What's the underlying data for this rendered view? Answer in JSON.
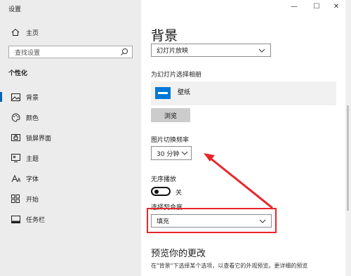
{
  "window": {
    "title": "设置"
  },
  "sidebar": {
    "home": "主页",
    "search_placeholder": "查找设置",
    "section": "个性化",
    "items": [
      {
        "label": "背景",
        "icon": "image-icon",
        "active": true
      },
      {
        "label": "颜色",
        "icon": "palette-icon",
        "active": false
      },
      {
        "label": "锁屏界面",
        "icon": "lock-screen-icon",
        "active": false
      },
      {
        "label": "主题",
        "icon": "theme-icon",
        "active": false
      },
      {
        "label": "字体",
        "icon": "font-icon",
        "active": false
      },
      {
        "label": "开始",
        "icon": "start-icon",
        "active": false
      },
      {
        "label": "任务栏",
        "icon": "taskbar-icon",
        "active": false
      }
    ]
  },
  "window_controls": {
    "minimize": "—",
    "maximize": "☐",
    "close": "✕"
  },
  "main": {
    "title": "背景",
    "background_type": "幻灯片放映",
    "album_label": "为幻灯片选择相册",
    "album_name": "壁纸",
    "browse_button": "浏览",
    "interval_label": "图片切换频率",
    "interval_value": "30 分钟",
    "shuffle_label": "无序播放",
    "shuffle_state": "关",
    "fit_label": "选择契合度",
    "fit_value": "填充",
    "preview_heading": "预览你的更改",
    "preview_text": "在\"背景\"下选择某个选项，以查看它的外观预览。更详细的预览"
  },
  "colors": {
    "accent": "#0063b1",
    "annotation": "#e8262a"
  }
}
